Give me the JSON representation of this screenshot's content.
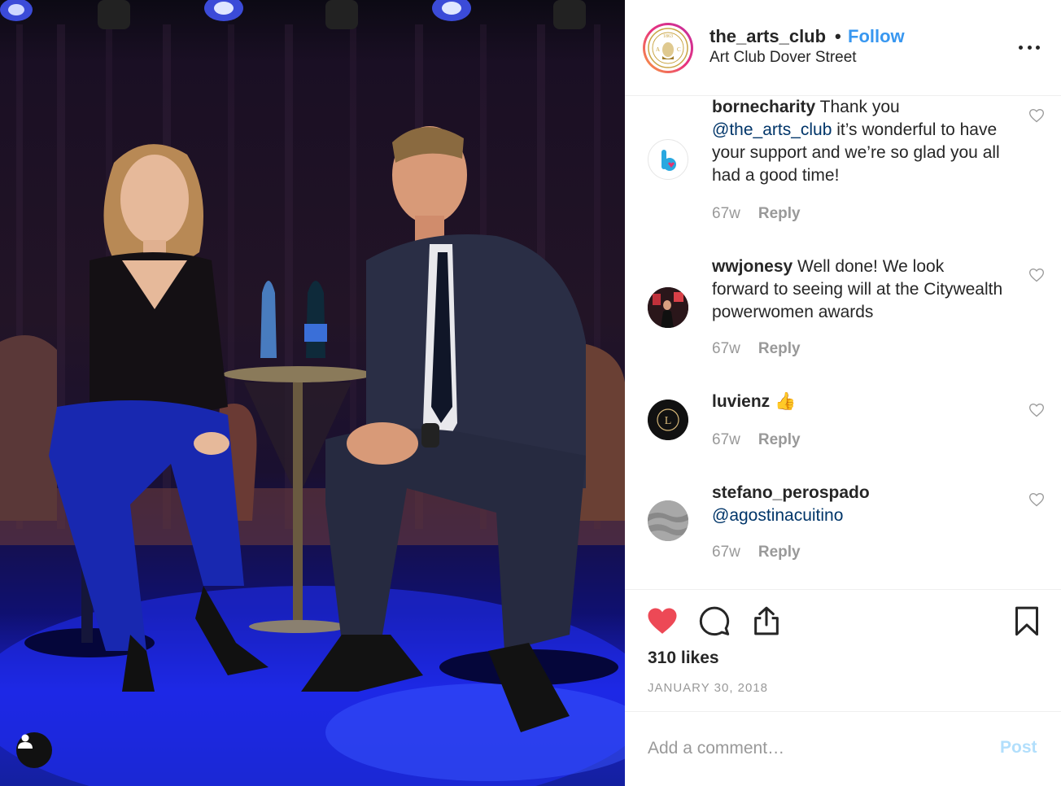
{
  "header": {
    "username": "the_arts_club",
    "separator": "•",
    "follow_label": "Follow",
    "location": "Art Club Dover Street",
    "avatar_icon": "arts-club-logo",
    "more_icon": "more-options-icon"
  },
  "comments": [
    {
      "username": "bornecharity",
      "text_before": " Thank you ",
      "mention": "@the_arts_club",
      "text_after": " it’s wonderful to have your support and we’re so glad you all had a good time!",
      "age": "67w",
      "reply_label": "Reply"
    },
    {
      "username": "wwjonesy",
      "text_before": " Well done! We look forward to seeing will at the Citywealth powerwomen awards",
      "mention": "",
      "text_after": "",
      "age": "67w",
      "reply_label": "Reply"
    },
    {
      "username": "luvienz",
      "text_before": " 👍",
      "mention": "",
      "text_after": "",
      "age": "67w",
      "reply_label": "Reply"
    },
    {
      "username": "stefano_perospado",
      "text_before": " ",
      "mention": "@agostinacuitino",
      "text_after": "",
      "age": "67w",
      "reply_label": "Reply"
    }
  ],
  "actions": {
    "likes": "310 likes",
    "date": "JANUARY 30, 2018",
    "like_icon": "heart-filled-icon",
    "comment_icon": "comment-bubble-icon",
    "share_icon": "share-icon",
    "save_icon": "bookmark-icon"
  },
  "add_comment": {
    "placeholder": "Add a comment…",
    "post_label": "Post"
  },
  "colors": {
    "accent": "#3897f0",
    "like_red": "#ed4956",
    "mention": "#003569",
    "muted": "#999999",
    "post_disabled": "#b2dffc"
  }
}
